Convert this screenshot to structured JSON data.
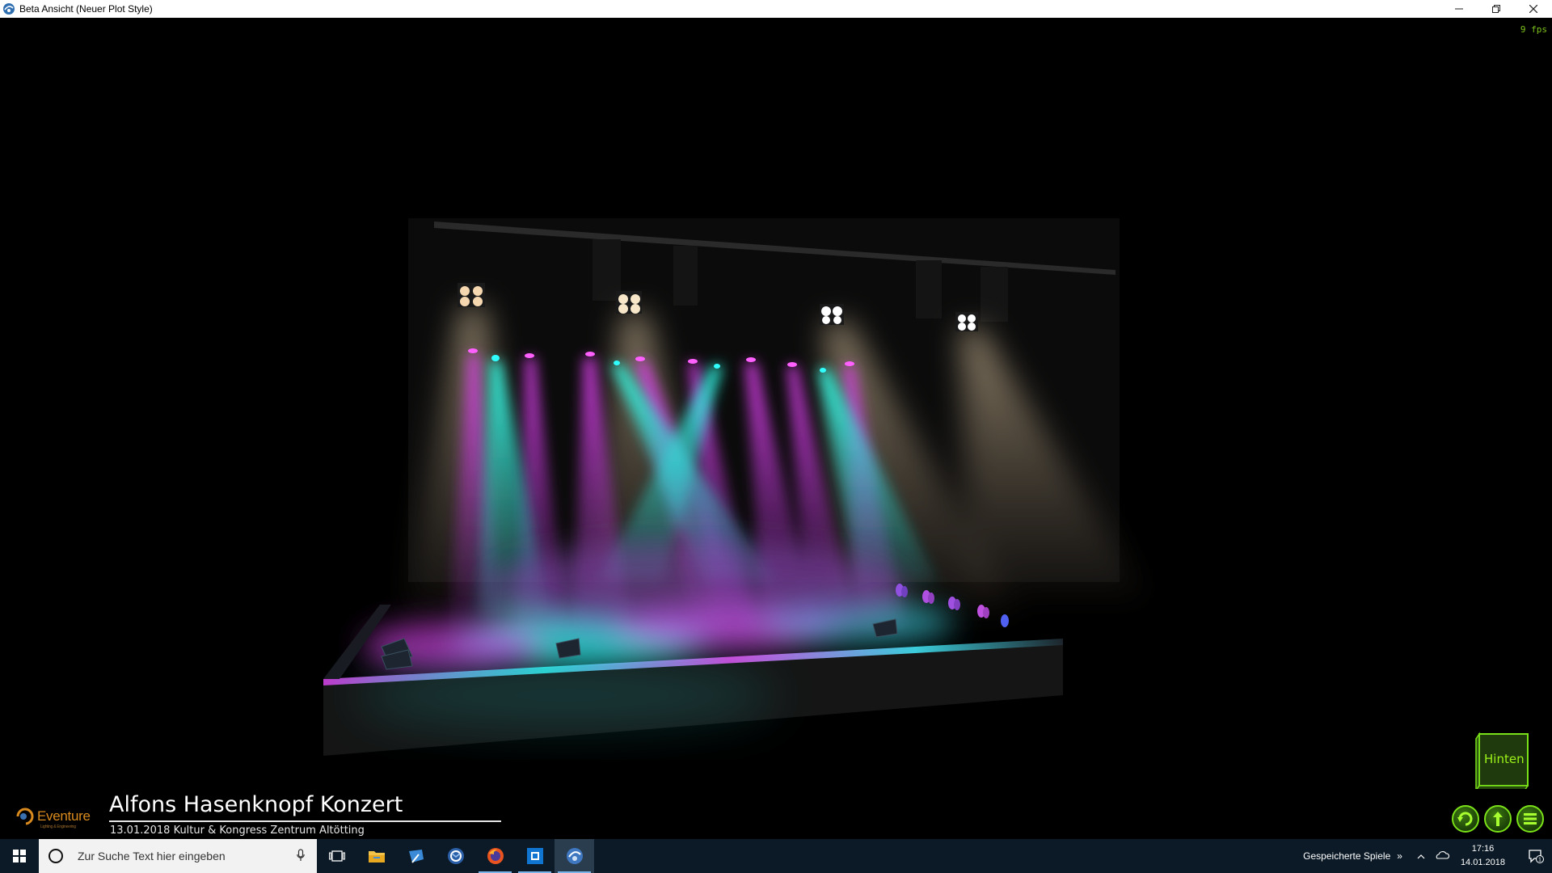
{
  "window": {
    "title": "Beta Ansicht  (Neuer Plot Style)",
    "minimize_icon": "minimize-icon",
    "restore_icon": "restore-icon",
    "close_icon": "close-icon"
  },
  "viewport": {
    "fps": "9 fps",
    "brand": {
      "name": "Eventure",
      "tagline": "Lighting & Engineering"
    },
    "show_title": "Alfons Hasenknopf Konzert",
    "show_subtitle": "13.01.2018 Kultur & Kongress Zentrum Altötting",
    "view_cube_label": "Hinten",
    "nav_buttons": [
      "rotate-icon",
      "move-icon",
      "menu-icon"
    ],
    "colors": {
      "accent_green": "#7ae018",
      "cyan": "#1fe0d8",
      "magenta": "#d030e0",
      "warm": "#f0d8b0"
    }
  },
  "taskbar": {
    "search_placeholder": "Zur Suche Text hier eingeben",
    "apps": [
      "task-view-icon",
      "file-explorer-icon",
      "app-icon",
      "outlook-icon",
      "firefox-icon",
      "store-icon",
      "app-current-icon"
    ],
    "tray": {
      "saved_games": "Gespeicherte Spiele",
      "time": "17:16",
      "date": "14.01.2018",
      "notification_count": "1"
    }
  }
}
